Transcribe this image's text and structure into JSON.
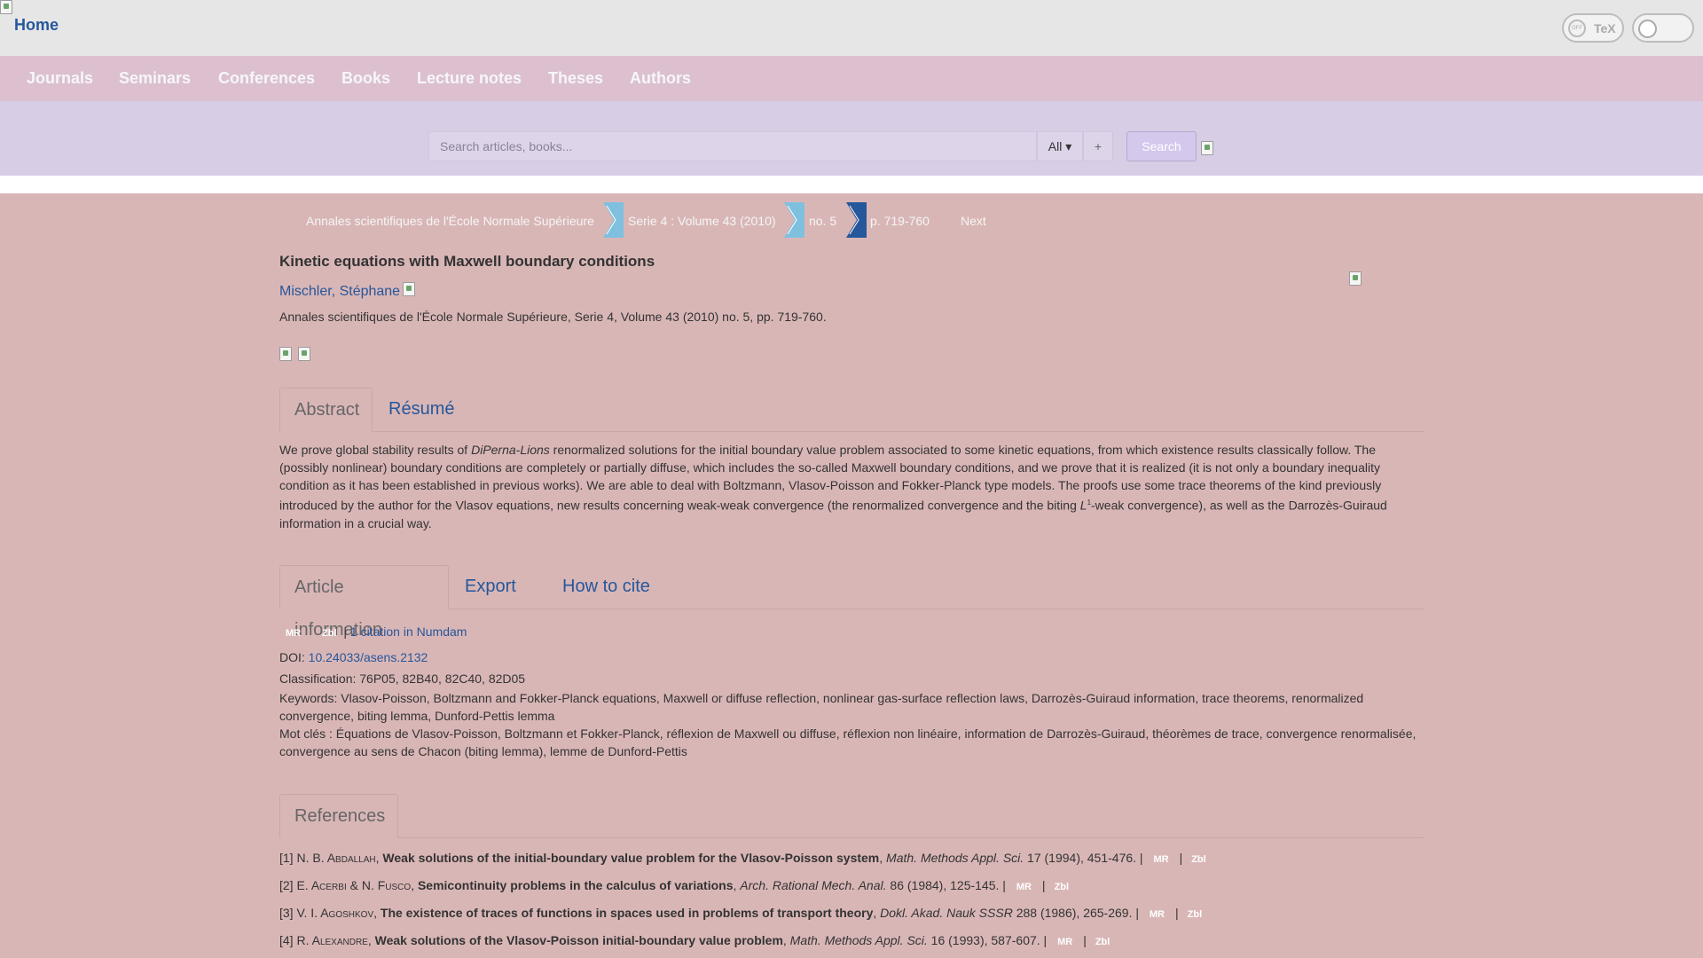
{
  "header": {
    "home_label": "Home",
    "tex_knob": "OFF",
    "tex_label": "TeX"
  },
  "nav": [
    "Journals",
    "Seminars",
    "Conferences",
    "Books",
    "Lecture notes",
    "Theses",
    "Authors"
  ],
  "search": {
    "placeholder": "Search articles, books...",
    "scope": "All ▾",
    "plus": "+",
    "button": " Search"
  },
  "breadcrumb": {
    "journal": "Annales scientifiques de l'École Normale Supérieure",
    "volume": "Serie 4 : Volume 43 (2010)",
    "issue": "no. 5",
    "pages": "p. 719-760",
    "next": "Next"
  },
  "article": {
    "title": "Kinetic equations with Maxwell boundary conditions",
    "author": "Mischler, Stéphane",
    "journal_line": "Annales scientifiques de l'École Normale Supérieure, Serie 4, Volume 43 (2010) no. 5, pp. 719-760."
  },
  "abstract_tabs": [
    "Abstract",
    "Résumé"
  ],
  "abstract": {
    "p1": "We prove global stability results of ",
    "p1_italic": "DiPerna-Lions",
    "p2": " renormalized solutions for the initial boundary value problem associated to some kinetic equations, from which existence results classically follow. The (possibly nonlinear) boundary conditions are completely or partially diffuse, which includes the so-called Maxwell boundary conditions, and we prove that it is realized (it is not only a boundary inequality condition as it has been established in previous works). We are able to deal with Boltzmann, Vlasov-Poisson and Fokker-Planck type models. The proofs use some trace theorems of the kind previously introduced by the author for the Vlasov equations, new results concerning weak-weak convergence (the renormalized convergence and the biting ",
    "math_L": "L",
    "math_sup": "1",
    "p3": "-weak convergence), as well as the Darrozès-Guiraud information in a crucial way."
  },
  "info_tabs": [
    "Article information",
    "Export",
    "How to cite"
  ],
  "info": {
    "mr": "MR",
    "zbl": "Zbl",
    "pipe": "|",
    "citations": "1 citation in Numdam",
    "doi_label": "DOI: ",
    "doi": "10.24033/asens.2132",
    "classification": "Classification: 76P05, 82B40, 82C40, 82D05",
    "keywords": "Keywords: Vlasov-Poisson, Boltzmann and Fokker-Planck equations, Maxwell or diffuse reflection, nonlinear gas-surface reflection laws, Darrozès-Guiraud information, trace theorems, renormalized convergence, biting lemma, Dunford-Pettis lemma",
    "mot_cles": "Mot clés : Équations de Vlasov-Poisson, Boltzmann et Fokker-Planck, réflexion de Maxwell ou diffuse, réflexion non linéaire, information de Darrozès-Guiraud, théorèmes de trace, convergence renormalisée, convergence au sens de Chacon (biting lemma), lemme de Dunford-Pettis"
  },
  "references_tab": "References",
  "references": [
    {
      "num": "[1] ",
      "initials": "N. B. A",
      "surname": "bdallah",
      "extra": "",
      "title": "Weak solutions of the initial-boundary value problem for the Vlasov-Poisson system",
      "journal": "Math. Methods Appl. Sci.",
      "details": " 17 (1994), 451-476. |"
    },
    {
      "num": "[2] ",
      "initials": "E. A",
      "surname": "cerbi",
      "extra": " & N. F",
      "extra_sc": "usco",
      "title": "Semicontinuity problems in the calculus of variations",
      "journal": "Arch. Rational Mech. Anal.",
      "details": " 86 (1984), 125-145. |"
    },
    {
      "num": "[3] ",
      "initials": "V. I. A",
      "surname": "goshkov",
      "extra": "",
      "title": "The existence of traces of functions in spaces used in problems of transport theory",
      "journal": "Dokl. Akad. Nauk SSSR",
      "details": " 288 (1986), 265-269. |"
    },
    {
      "num": "[4] ",
      "initials": "R. A",
      "surname": "lexandre",
      "extra": "",
      "title": "Weak solutions of the Vlasov-Poisson initial-boundary value problem",
      "journal": "Math. Methods Appl. Sci.",
      "details": " 16 (1993), 587-607. |"
    }
  ],
  "colors": {
    "link": "#26579a",
    "background": "#d9b6b6",
    "nav_bg": "#dcc0d0",
    "search_bg": "#d7cde5",
    "chevron_light": "#7fc0df",
    "chevron_dark": "#26579a"
  }
}
